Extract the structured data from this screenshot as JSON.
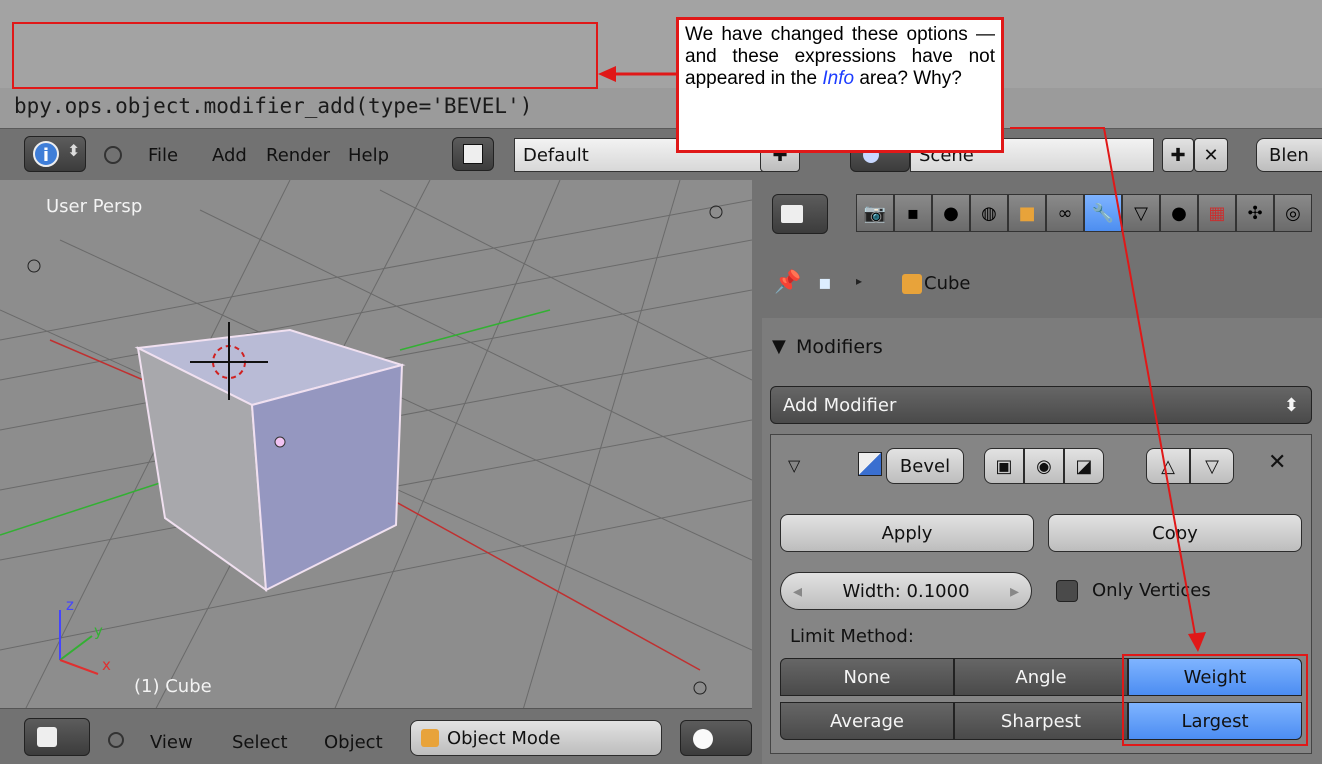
{
  "info": {
    "log_line": "bpy.ops.object.modifier_add(type='BEVEL')"
  },
  "header": {
    "menus": [
      "File",
      "Add",
      "Render",
      "Help"
    ],
    "layout_name": "Default",
    "scene_name": "Scene",
    "engine_partial": "Blen"
  },
  "viewport": {
    "view_label": "User Persp",
    "object_label": "(1) Cube",
    "axes": {
      "z": "z",
      "y": "y",
      "x": "x"
    }
  },
  "bottom_bar": {
    "menus": [
      "View",
      "Select",
      "Object"
    ],
    "mode": "Object Mode"
  },
  "properties": {
    "breadcrumb_object": "Cube",
    "panel_title": "Modifiers",
    "add_modifier": "Add Modifier",
    "modifier_name": "Bevel",
    "apply_label": "Apply",
    "copy_label": "Copy",
    "width_field": "Width: 0.1000",
    "only_vertices_label": "Only Vertices",
    "limit_method_label": "Limit Method:",
    "limit_row1": [
      "None",
      "Angle",
      "Weight"
    ],
    "limit_row2": [
      "Average",
      "Sharpest",
      "Largest"
    ]
  },
  "callout": {
    "text_before": "We have changed these options — and these expressions have not appeared in the ",
    "emph": "Info",
    "text_after": " area? Why?"
  },
  "colors": {
    "annotation_red": "#e01818",
    "active_blue": "#5c97f5",
    "viewport_gray": "#8d8d8d"
  }
}
